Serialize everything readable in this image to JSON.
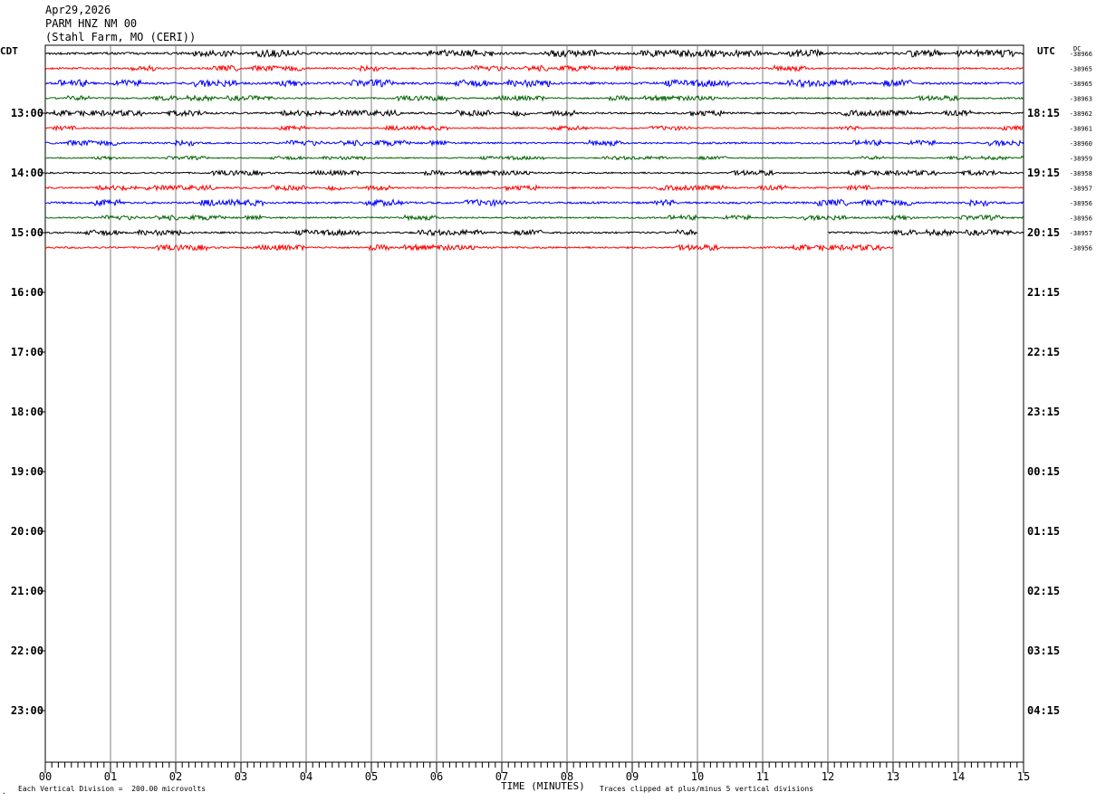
{
  "header": {
    "date": "Apr29,2026",
    "station": "PARM HNZ NM 00",
    "location": "(Stahl Farm, MO (CERI))"
  },
  "left_corner_label": "CDT",
  "right_corner_label": "UTC",
  "dc_label": "DC",
  "footer": {
    "scale_note": "Each Vertical Division =  200.00 microvolts",
    "x_title": "TIME (MINUTES)",
    "clip_note": "Traces clipped at plus/minus 5 vertical divisions"
  },
  "colors": {
    "black": "#000000",
    "red": "#ff0000",
    "blue": "#0000ff",
    "green": "#006400",
    "grid": "#808080"
  },
  "chart_data": {
    "type": "line",
    "title": "",
    "xlabel": "TIME (MINUTES)",
    "x_ticks": [
      "00",
      "01",
      "02",
      "03",
      "04",
      "05",
      "06",
      "07",
      "08",
      "09",
      "10",
      "11",
      "12",
      "13",
      "14",
      "15"
    ],
    "xlim": [
      0,
      15
    ],
    "left_hour_labels": [
      "13:00",
      "14:00",
      "15:00",
      "16:00",
      "17:00",
      "18:00",
      "19:00",
      "20:00",
      "21:00",
      "22:00",
      "23:00"
    ],
    "right_hour_labels": [
      "18:15",
      "19:15",
      "20:15",
      "21:15",
      "22:15",
      "23:15",
      "00:15",
      "01:15",
      "02:15",
      "03:15",
      "04:15"
    ],
    "row_minutes_per_trace": 15,
    "traces": [
      {
        "row": 0,
        "color": "black",
        "dc": "-38966",
        "start": 0,
        "end": 15,
        "amp": 1.0
      },
      {
        "row": 1,
        "color": "red",
        "dc": "-38965",
        "start": 0,
        "end": 15,
        "amp": 0.8
      },
      {
        "row": 2,
        "color": "blue",
        "dc": "-38965",
        "start": 0,
        "end": 15,
        "amp": 1.0
      },
      {
        "row": 3,
        "color": "green",
        "dc": "-38963",
        "start": 0,
        "end": 15,
        "amp": 0.7
      },
      {
        "row": 4,
        "color": "black",
        "dc": "-38962",
        "start": 0,
        "end": 15,
        "amp": 0.8
      },
      {
        "row": 5,
        "color": "red",
        "dc": "-38961",
        "start": 0,
        "end": 15,
        "amp": 0.6
      },
      {
        "row": 6,
        "color": "blue",
        "dc": "-38960",
        "start": 0,
        "end": 15,
        "amp": 0.8
      },
      {
        "row": 7,
        "color": "green",
        "dc": "-38959",
        "start": 0,
        "end": 15,
        "amp": 0.5
      },
      {
        "row": 8,
        "color": "black",
        "dc": "-38958",
        "start": 0,
        "end": 15,
        "amp": 0.7
      },
      {
        "row": 9,
        "color": "red",
        "dc": "-38957",
        "start": 0,
        "end": 15,
        "amp": 0.7
      },
      {
        "row": 10,
        "color": "blue",
        "dc": "-38956",
        "start": 0,
        "end": 15,
        "amp": 0.9
      },
      {
        "row": 11,
        "color": "green",
        "dc": "-38956",
        "start": 0,
        "end": 15,
        "amp": 0.7
      },
      {
        "row": 12,
        "color": "black",
        "dc": "-38957",
        "start": 0,
        "end": 10,
        "amp": 0.8,
        "resume": 12
      },
      {
        "row": 13,
        "color": "red",
        "dc": "-38956",
        "start": 0,
        "end": 13,
        "amp": 0.8
      }
    ]
  }
}
